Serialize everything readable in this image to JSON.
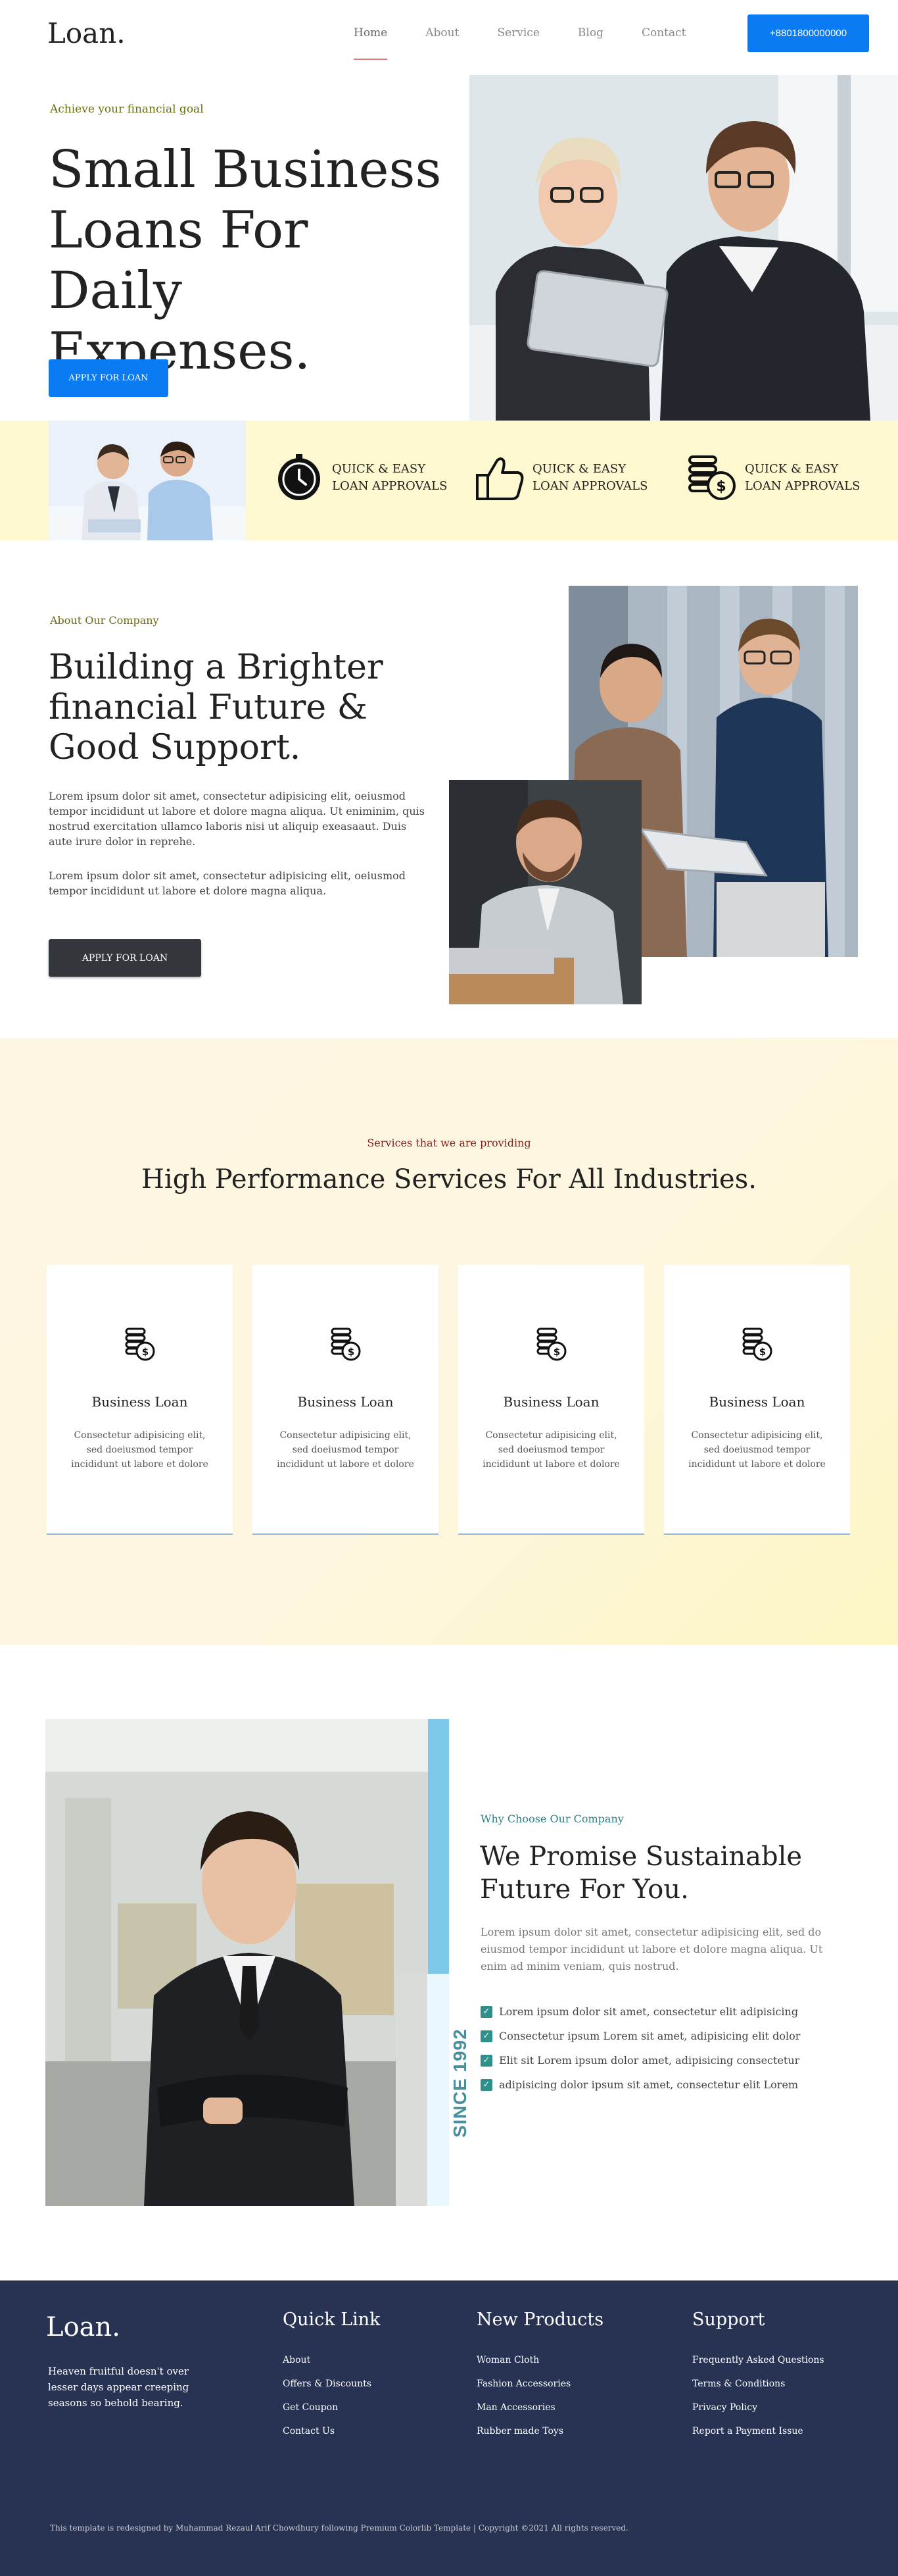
{
  "header": {
    "logo": "Loan.",
    "nav": [
      "Home",
      "About",
      "Service",
      "Blog",
      "Contact"
    ],
    "active_nav": "Home",
    "phone": "+8801800000000",
    "accent": "#0b7bf4"
  },
  "hero": {
    "eyebrow": "Achieve your financial goal",
    "title": "Small Business Loans For Daily Expenses.",
    "button": "APPLY FOR LOAN"
  },
  "features": [
    {
      "icon": "stopwatch-icon",
      "text": "QUICK & EASY LOAN APPROVALS"
    },
    {
      "icon": "thumbs-up-icon",
      "text": "QUICK & EASY LOAN APPROVALS"
    },
    {
      "icon": "coins-icon",
      "text": "QUICK & EASY LOAN APPROVALS"
    }
  ],
  "about": {
    "eyebrow": "About Our Company",
    "title": "Building a Brighter financial Future & Good Support.",
    "p1": "Lorem ipsum dolor sit amet, consectetur adipisicing elit, oeiusmod tempor incididunt ut labore et dolore magna aliqua. Ut eniminim, quis nostrud exercitation ullamco laboris nisi ut aliquip exeasaaut. Duis aute irure dolor in reprehe.",
    "p2": "Lorem ipsum dolor sit amet, consectetur adipisicing elit, oeiusmod tempor incididunt ut labore et dolore magna aliqua.",
    "button": "APPLY FOR LOAN"
  },
  "services": {
    "subtitle": "Services that we are providing",
    "title": "High Performance Services For All Industries.",
    "cards": [
      {
        "title": "Business Loan",
        "text": "Consectetur adipisicing elit, sed doeiusmod tempor incididunt ut labore et dolore"
      },
      {
        "title": "Business Loan",
        "text": "Consectetur adipisicing elit, sed doeiusmod tempor incididunt ut labore et dolore"
      },
      {
        "title": "Business Loan",
        "text": "Consectetur adipisicing elit, sed doeiusmod tempor incididunt ut labore et dolore"
      },
      {
        "title": "Business Loan",
        "text": "Consectetur adipisicing elit, sed doeiusmod tempor incididunt ut labore et dolore"
      }
    ]
  },
  "why": {
    "since": "SINCE 1992",
    "eyebrow": "Why Choose Our Company",
    "title": "We Promise Sustainable Future For You.",
    "text": "Lorem ipsum dolor sit amet, consectetur adipisicing elit, sed do eiusmod tempor incididunt ut labore et dolore magna aliqua. Ut enim ad minim veniam, quis nostrud.",
    "checks": [
      "Lorem ipsum dolor sit amet, consectetur elit adipisicing",
      "Consectetur ipsum Lorem sit amet, adipisicing elit dolor",
      "Elit sit Lorem ipsum dolor amet, adipisicing consectetur",
      "adipisicing dolor ipsum sit amet, consectetur elit Lorem"
    ]
  },
  "footer": {
    "logo": "Loan.",
    "description": "Heaven fruitful doesn't over lesser days appear creeping seasons so behold bearing.",
    "columns": [
      {
        "title": "Quick Link",
        "links": [
          "About",
          "Offers & Discounts",
          "Get Coupon",
          "Contact Us"
        ]
      },
      {
        "title": "New Products",
        "links": [
          "Woman Cloth",
          "Fashion Accessories",
          "Man Accessories",
          "Rubber made Toys"
        ]
      },
      {
        "title": "Support",
        "links": [
          "Frequently Asked Questions",
          "Terms & Conditions",
          "Privacy Policy",
          "Report a Payment Issue"
        ]
      }
    ],
    "copyright": "This template is redesigned by Muhammad Rezaul Arif Chowdhury following Premium Colorlib Template | Copyright ©2021 All rights reserved.",
    "background": "#283354"
  }
}
